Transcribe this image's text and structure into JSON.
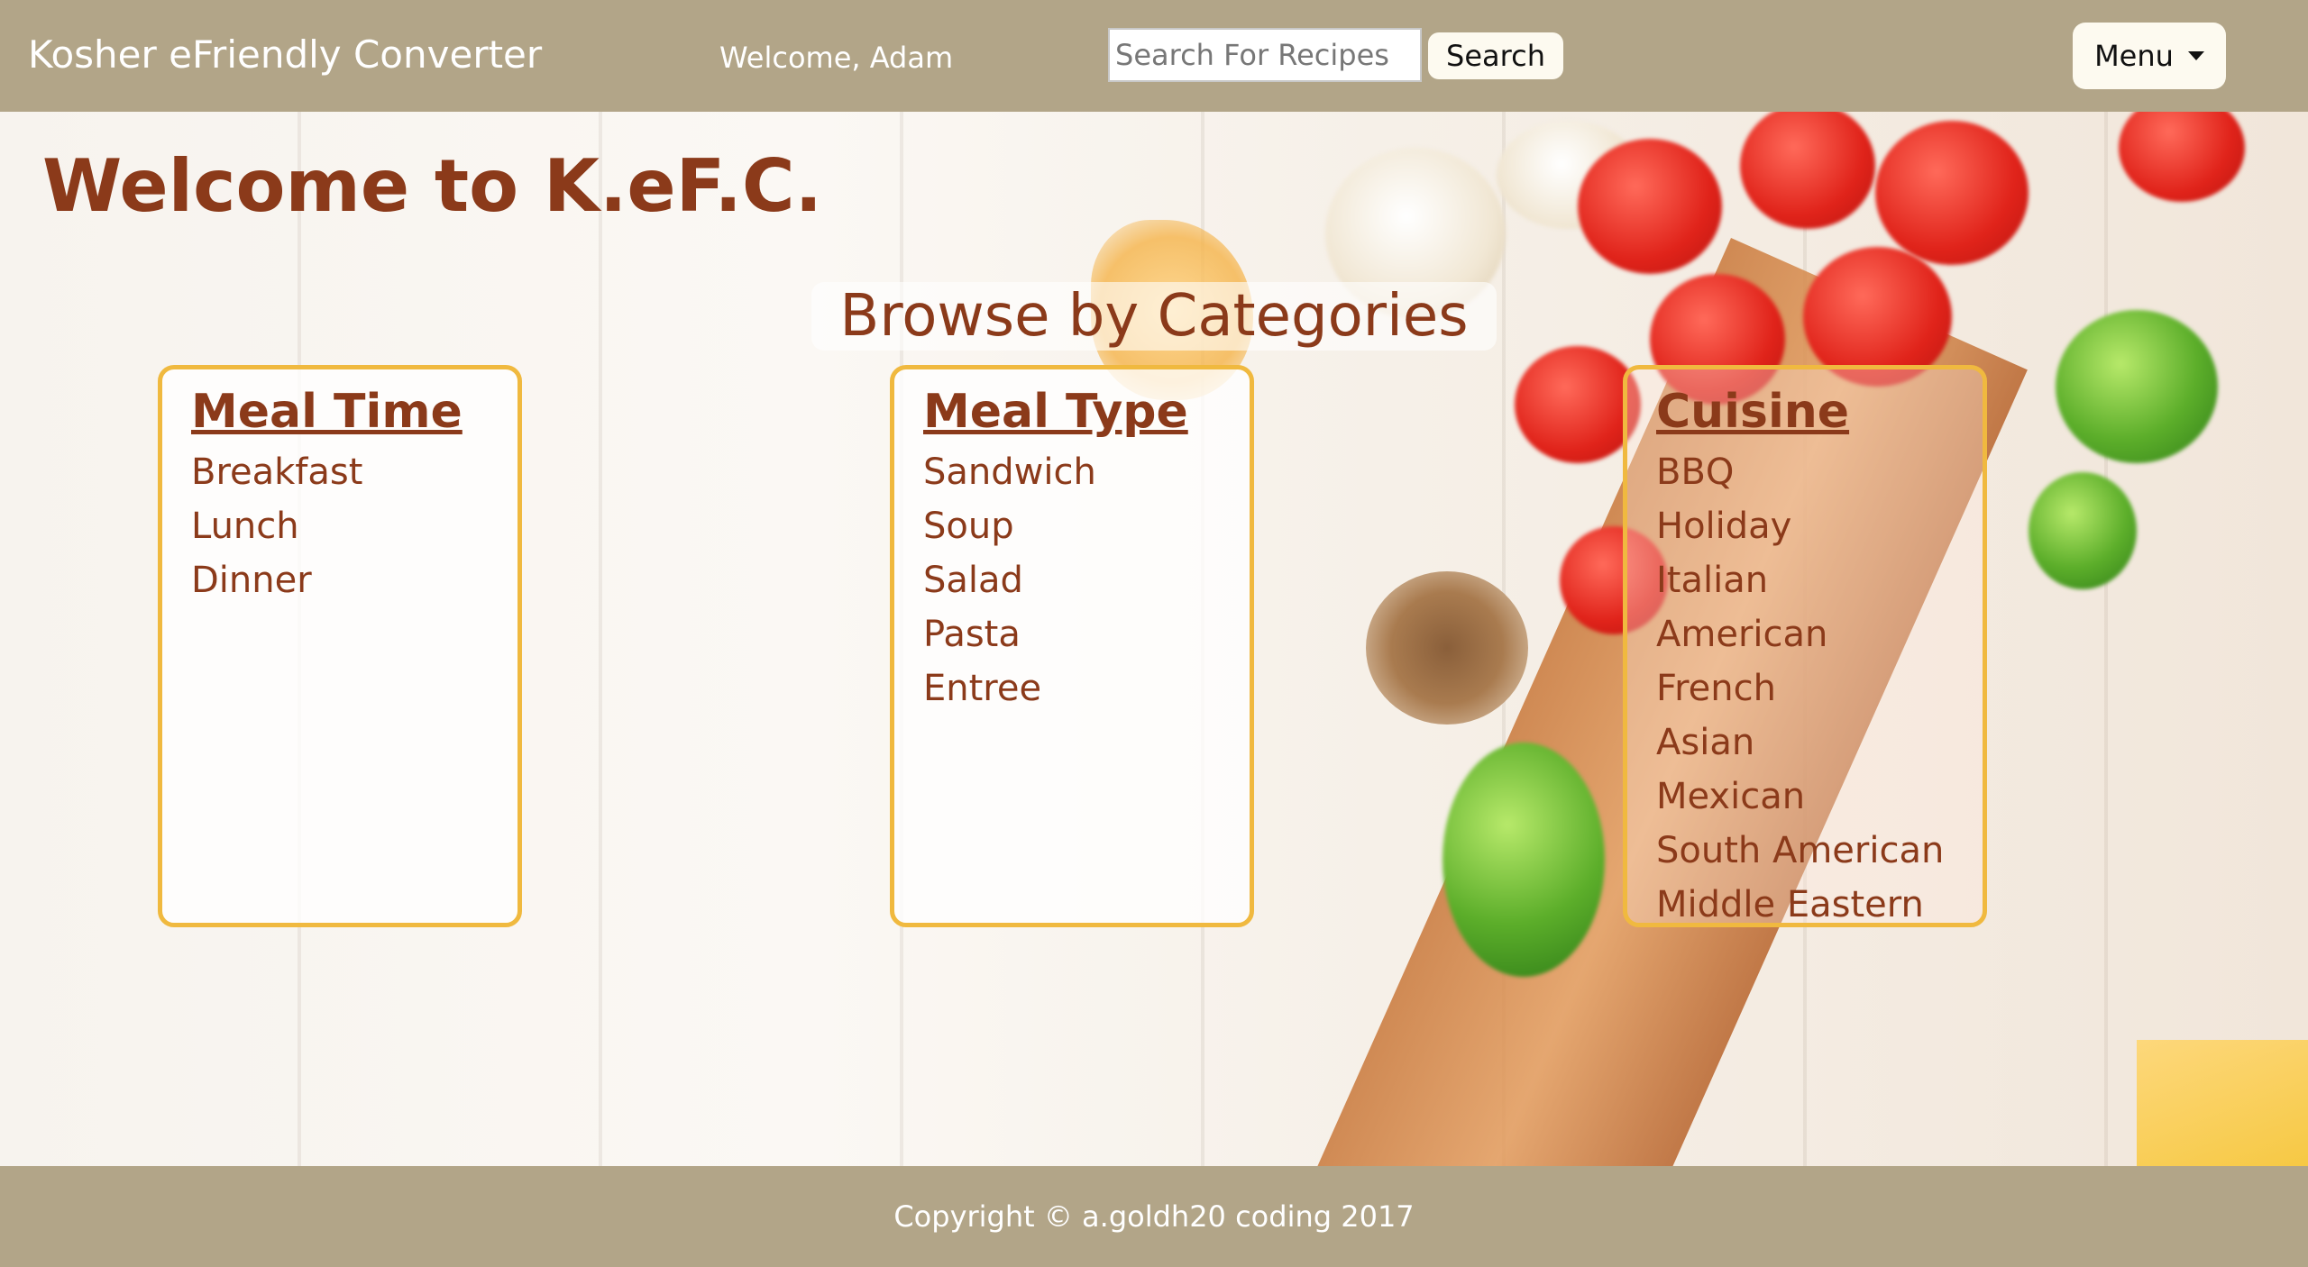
{
  "navbar": {
    "brand": "Kosher eFriendly Converter",
    "welcome": "Welcome, Adam",
    "search_placeholder": "Search For Recipes",
    "search_button": "Search",
    "menu_button": "Menu"
  },
  "main": {
    "title": "Welcome to K.eF.C.",
    "browse_heading": "Browse by Categories",
    "categories": [
      {
        "title": "Meal Time",
        "items": [
          "Breakfast",
          "Lunch",
          "Dinner"
        ]
      },
      {
        "title": "Meal Type",
        "items": [
          "Sandwich",
          "Soup",
          "Salad",
          "Pasta",
          "Entree"
        ]
      },
      {
        "title": "Cuisine",
        "items": [
          "BBQ",
          "Holiday",
          "Italian",
          "American",
          "French",
          "Asian",
          "Mexican",
          "South American",
          "Middle Eastern"
        ]
      }
    ]
  },
  "footer": {
    "copyright": "Copyright © a.goldh20 coding 2017"
  },
  "colors": {
    "navbar": "#b2a588",
    "heading": "#8b3a1a",
    "box_border": "#f0b93f"
  }
}
